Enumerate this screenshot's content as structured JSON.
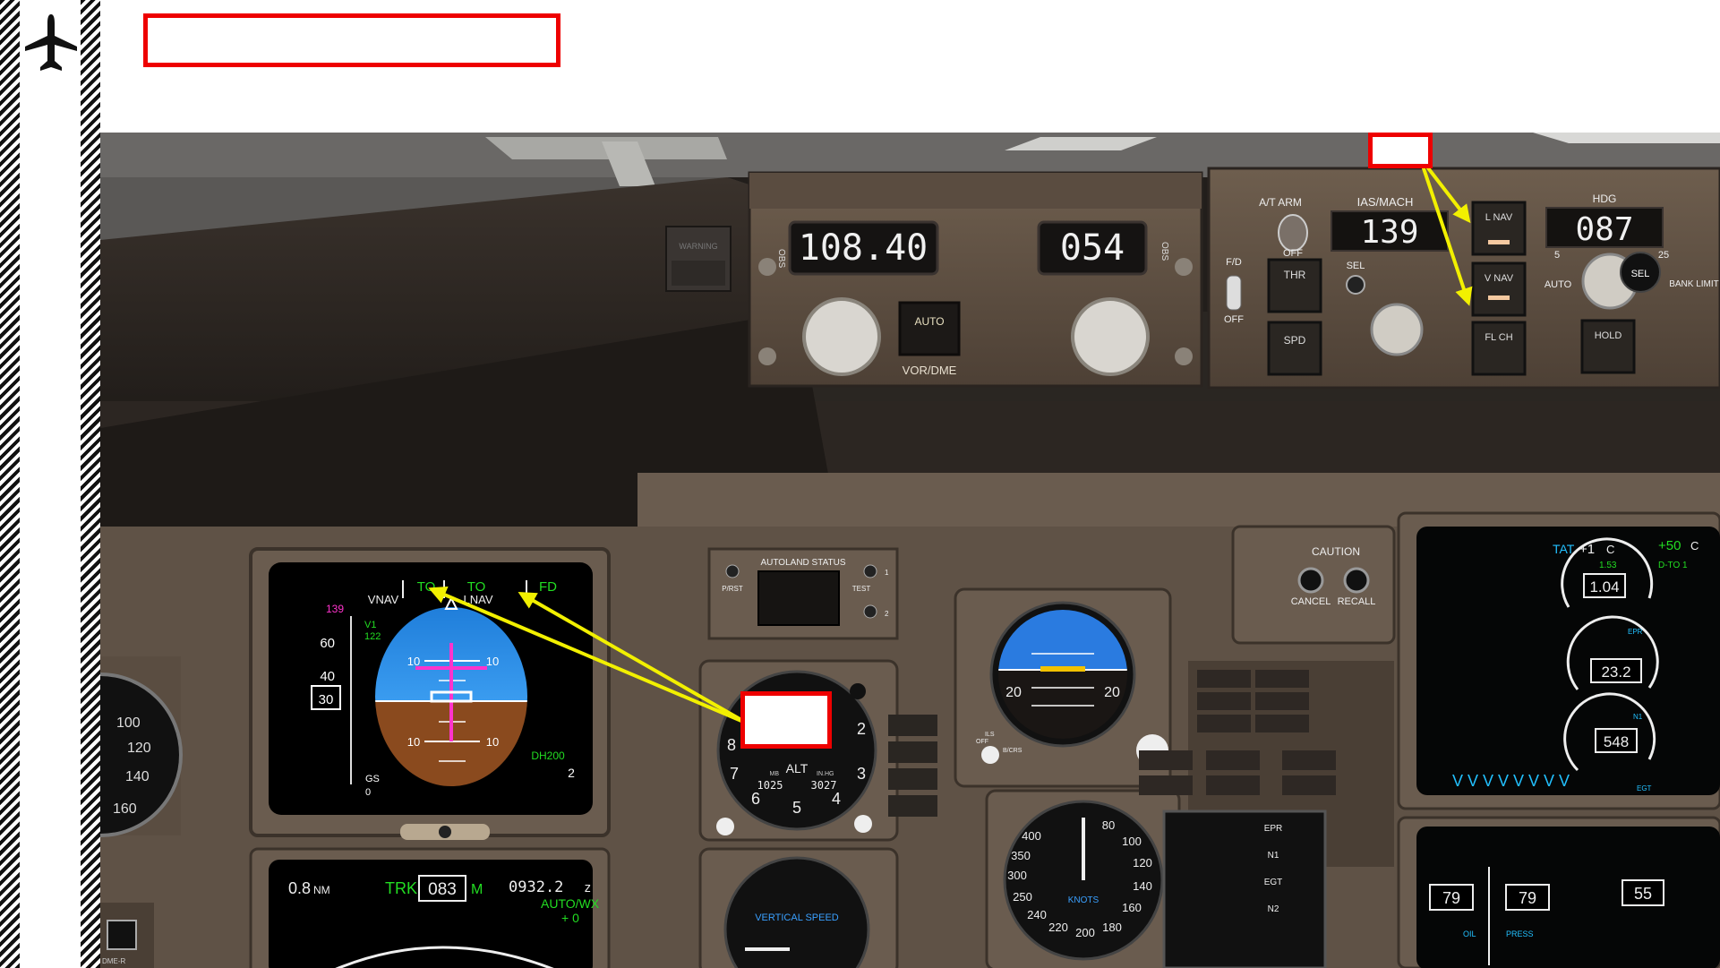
{
  "tutorial": {
    "title": "",
    "callout_top": "",
    "callout_adi": ""
  },
  "icons": {
    "aircraft": "airplane-icon"
  },
  "colors": {
    "accent_red": "#e00000",
    "arrow_yellow": "#f2f000",
    "pfd_green": "#22dd22",
    "pfd_magenta": "#ff33cc"
  },
  "cockpit": {
    "warning_label": "WARNING",
    "efis": {
      "left_label": "OBS",
      "freq": "108.40",
      "course": "054",
      "auto_label": "AUTO",
      "vor_dme_label": "VOR/DME",
      "right_label": "OBS"
    },
    "mcp": {
      "at_arm_label": "A/T ARM",
      "off_label": "OFF",
      "fd_label": "F/D",
      "ias_mach_label": "IAS/MACH",
      "ias_value": "139",
      "sel_label": "SEL",
      "thr_button": "THR",
      "spd_button": "SPD",
      "lnav_button": "L NAV",
      "vnav_button": "V NAV",
      "flch_button": "FL CH",
      "hdg_label": "HDG",
      "hdg_value": "087",
      "hdg_sel_button": "SEL",
      "hdg_auto_label": "AUTO",
      "hold_button": "HOLD",
      "bank_limit_label": "BANK LIMIT",
      "bank_5": "5",
      "bank_25": "25"
    },
    "pfd": {
      "fma_to_1": "TO",
      "fma_vnav": "VNAV",
      "fma_to_2": "TO",
      "fma_lnav": "LNAV",
      "fma_fd": "FD",
      "speed_bug": "139",
      "v1": "V1",
      "v1_value": "122",
      "speed_60": "60",
      "speed_40": "40",
      "speed_30": "30",
      "pitch_10": "10",
      "dh": "DH200",
      "dh_value": "2",
      "gs": "GS",
      "gs_value": "0"
    },
    "autoland": {
      "title": "AUTOLAND STATUS",
      "prst": "P/RST",
      "test": "TEST",
      "n1": "1",
      "n2": "2"
    },
    "altimeter": {
      "label": "ALT",
      "mb": "MB",
      "inhg": "IN.HG",
      "mb_value": "1025",
      "inhg_value": "3027"
    },
    "vsi": {
      "label": "VERTICAL SPEED"
    },
    "caution": {
      "title": "CAUTION",
      "cancel": "CANCEL",
      "recall": "RECALL"
    },
    "asi": {
      "label": "KNOTS",
      "ticks": [
        "400",
        "350",
        "300",
        "250",
        "240",
        "220",
        "200",
        "180",
        "160",
        "140",
        "120",
        "100",
        "80"
      ]
    },
    "adi_standby": {
      "pitch_left": "20",
      "pitch_right": "20",
      "off_label": "OFF",
      "ils_label": "ILS",
      "bcrs_label": "B/CRS"
    },
    "eicas": {
      "tat_label": "TAT",
      "tat_value": "+1",
      "tat_unit": "C",
      "temp_value": "+50",
      "temp_unit": "C",
      "epr_ref": "1.53",
      "epr_value": "1.04",
      "n1_value": "23.2",
      "egt_value": "548",
      "epr_label": "EPR",
      "n1_label": "N1",
      "egt_label": "EGT",
      "d_to_label": "D-TO 1"
    },
    "nd": {
      "range": "0.8",
      "range_unit": "NM",
      "trk_label": "TRK",
      "trk_value": "083",
      "trk_unit": "M",
      "time": "0932.2",
      "time_unit": "z",
      "auto_wx": "AUTO/WX",
      "plus_zero": "+ 0",
      "dme_label": "DME-R"
    },
    "lower_eicas": {
      "left_val": "79",
      "right_val": "79",
      "val_55": "55",
      "oil_label": "OIL",
      "press_label": "PRESS"
    },
    "standby_eng_labels": [
      "EPR",
      "N1",
      "EGT",
      "N2"
    ]
  }
}
